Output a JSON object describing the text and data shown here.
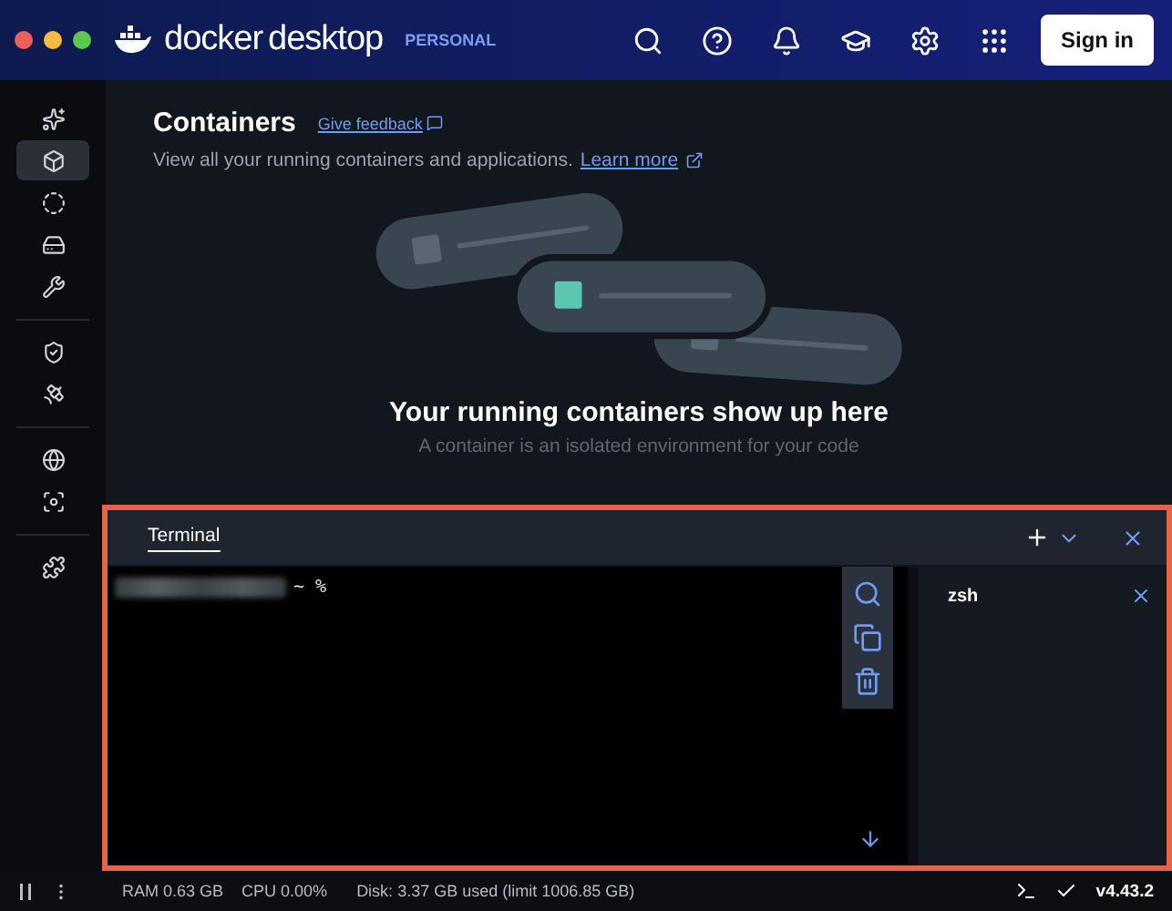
{
  "title_bar": {
    "brand": "docker",
    "product": "desktop",
    "plan": "PERSONAL",
    "sign_in": "Sign in"
  },
  "sidebar": {
    "groups": [
      [
        {
          "selected": false
        },
        {
          "selected": true
        },
        {
          "selected": false
        },
        {
          "selected": false
        },
        {
          "selected": false
        }
      ],
      [
        {
          "selected": false
        },
        {
          "selected": false
        }
      ],
      [
        {
          "selected": false
        },
        {
          "selected": false
        }
      ],
      [
        {
          "selected": false
        }
      ]
    ]
  },
  "page": {
    "title": "Containers",
    "feedback_link": "Give feedback",
    "description": "View all your running containers and applications.",
    "learn_more": "Learn more",
    "empty_title": "Your running containers show up here",
    "empty_text": "A container is an isolated environment for your code"
  },
  "terminal": {
    "tabs": [
      {
        "label": "Terminal",
        "selected": true
      }
    ],
    "prompt": "~ %",
    "sessions": [
      {
        "label": "zsh",
        "selected": true
      }
    ]
  },
  "status_bar": {
    "ram": "RAM 0.63 GB",
    "cpu": "CPU 0.00%",
    "disk": "Disk: 3.37 GB used (limit 1006.85 GB)",
    "version": "v4.43.2"
  }
}
